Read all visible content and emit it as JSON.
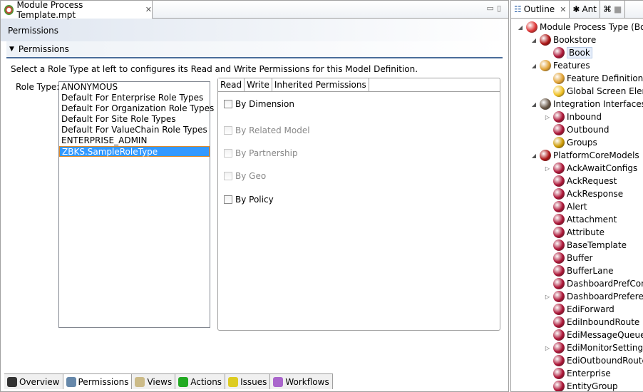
{
  "editor": {
    "tab_title": "Module Process Template.mpt",
    "form_title": "Permissions",
    "section_title": "Permissions",
    "description": "Select a Role Type at left to configures its Read and Write Permissions for this Model Definition.",
    "role_label": "Role Type:",
    "roles": [
      "ANONYMOUS",
      "Default For Enterprise Role Types",
      "Default For Organization Role Types",
      "Default For Site Role Types",
      "Default For ValueChain Role Types",
      "ENTERPRISE_ADMIN",
      "ZBKS.SampleRoleType"
    ],
    "selected_role": "ZBKS.SampleRoleType",
    "perm_tabs": [
      "Read",
      "Write",
      "Inherited Permissions"
    ],
    "active_perm_tab": "Read",
    "checks": [
      {
        "label": "By Dimension",
        "enabled": true,
        "checked": false
      },
      {
        "label": "By Related Model",
        "enabled": false,
        "checked": false
      },
      {
        "label": "By Partnership",
        "enabled": false,
        "checked": false
      },
      {
        "label": "By Geo",
        "enabled": false,
        "checked": false
      },
      {
        "label": "By Policy",
        "enabled": true,
        "checked": false
      }
    ],
    "bottom_tabs": [
      {
        "label": "Overview",
        "icon": "binoculars-icon"
      },
      {
        "label": "Permissions",
        "icon": "person-icon"
      },
      {
        "label": "Views",
        "icon": "views-icon"
      },
      {
        "label": "Actions",
        "icon": "refresh-arrow-icon"
      },
      {
        "label": "Issues",
        "icon": "warning-icon"
      },
      {
        "label": "Workflows",
        "icon": "workflow-icon"
      }
    ],
    "active_bottom_tab": "Permissions"
  },
  "outline": {
    "tabs": [
      "Outline",
      "Ant",
      ""
    ],
    "tree": [
      {
        "label": "Module Process Type (Boo",
        "level": 0,
        "state": "expanded",
        "color": "#d33"
      },
      {
        "label": "Bookstore",
        "level": 1,
        "state": "expanded",
        "color": "#a11"
      },
      {
        "label": "Book",
        "level": 2,
        "state": "leaf",
        "color": "#a13",
        "selected": true
      },
      {
        "label": "Features",
        "level": 1,
        "state": "expanded",
        "color": "#e0a030"
      },
      {
        "label": "Feature Definitions",
        "level": 2,
        "state": "leaf",
        "color": "#e0a030"
      },
      {
        "label": "Global Screen Elem",
        "level": 2,
        "state": "leaf",
        "color": "#f0c020"
      },
      {
        "label": "Integration Interfaces",
        "level": 1,
        "state": "expanded",
        "color": "#654"
      },
      {
        "label": "Inbound",
        "level": 2,
        "state": "collapsed",
        "color": "#a13"
      },
      {
        "label": "Outbound",
        "level": 2,
        "state": "leaf",
        "color": "#a13"
      },
      {
        "label": "Groups",
        "level": 2,
        "state": "leaf",
        "color": "#c90"
      },
      {
        "label": "PlatformCoreModels",
        "level": 1,
        "state": "expanded",
        "color": "#a11"
      },
      {
        "label": "AckAwaitConfigs",
        "level": 2,
        "state": "collapsed",
        "color": "#a13"
      },
      {
        "label": "AckRequest",
        "level": 2,
        "state": "leaf",
        "color": "#a13"
      },
      {
        "label": "AckResponse",
        "level": 2,
        "state": "leaf",
        "color": "#a13"
      },
      {
        "label": "Alert",
        "level": 2,
        "state": "leaf",
        "color": "#a13"
      },
      {
        "label": "Attachment",
        "level": 2,
        "state": "leaf",
        "color": "#a13"
      },
      {
        "label": "Attribute",
        "level": 2,
        "state": "leaf",
        "color": "#a13"
      },
      {
        "label": "BaseTemplate",
        "level": 2,
        "state": "leaf",
        "color": "#a13"
      },
      {
        "label": "Buffer",
        "level": 2,
        "state": "leaf",
        "color": "#a13"
      },
      {
        "label": "BufferLane",
        "level": 2,
        "state": "leaf",
        "color": "#a13"
      },
      {
        "label": "DashboardPrefCons",
        "level": 2,
        "state": "leaf",
        "color": "#a13"
      },
      {
        "label": "DashboardPreferen",
        "level": 2,
        "state": "collapsed",
        "color": "#a13"
      },
      {
        "label": "EdiForward",
        "level": 2,
        "state": "leaf",
        "color": "#a13"
      },
      {
        "label": "EdiInboundRoute",
        "level": 2,
        "state": "leaf",
        "color": "#a13"
      },
      {
        "label": "EdiMessageQueue",
        "level": 2,
        "state": "leaf",
        "color": "#a13"
      },
      {
        "label": "EdiMonitorSettings",
        "level": 2,
        "state": "collapsed",
        "color": "#a13"
      },
      {
        "label": "EdiOutboundRoute",
        "level": 2,
        "state": "leaf",
        "color": "#a13"
      },
      {
        "label": "Enterprise",
        "level": 2,
        "state": "leaf",
        "color": "#a13"
      },
      {
        "label": "EntityGroup",
        "level": 2,
        "state": "leaf",
        "color": "#a13"
      }
    ]
  }
}
